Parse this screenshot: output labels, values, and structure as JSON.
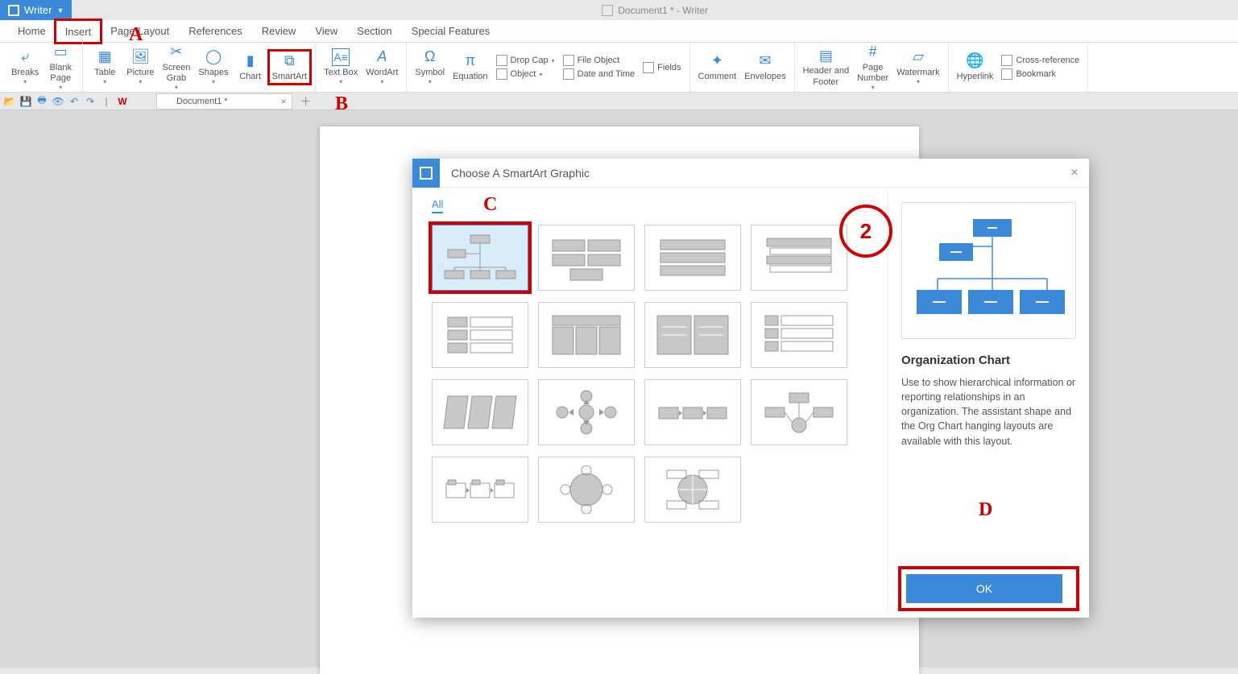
{
  "app": {
    "name": "Writer",
    "title": "Document1 * - Writer"
  },
  "menu": {
    "tabs": [
      "Home",
      "Insert",
      "Page Layout",
      "References",
      "Review",
      "View",
      "Section",
      "Special Features"
    ],
    "active": "Insert"
  },
  "ribbon": {
    "breaks": "Breaks",
    "blank_page": "Blank\nPage",
    "table": "Table",
    "picture": "Picture",
    "screen_grab": "Screen\nGrab",
    "shapes": "Shapes",
    "chart": "Chart",
    "smartart": "SmartArt",
    "text_box": "Text Box",
    "wordart": "WordArt",
    "symbol": "Symbol",
    "equation": "Equation",
    "drop_cap": "Drop Cap",
    "file_object": "File Object",
    "object": "Object",
    "date_time": "Date and Time",
    "fields": "Fields",
    "comment": "Comment",
    "envelopes": "Envelopes",
    "header_footer": "Header and\nFooter",
    "page_number": "Page\nNumber",
    "watermark": "Watermark",
    "hyperlink": "Hyperlink",
    "bookmark": "Bookmark",
    "cross_ref": "Cross-reference"
  },
  "doc_tab": {
    "label": "Document1 *"
  },
  "dialog": {
    "title": "Choose A SmartArt Graphic",
    "category": "All",
    "selected_name": "Organization Chart",
    "description": "Use to show hierarchical information or reporting relationships in an organization. The assistant shape and the Org Chart hanging layouts are available with this layout.",
    "ok": "OK"
  },
  "annotations": {
    "A": "A",
    "B": "B",
    "C": "C",
    "D": "D",
    "num2": "2"
  }
}
